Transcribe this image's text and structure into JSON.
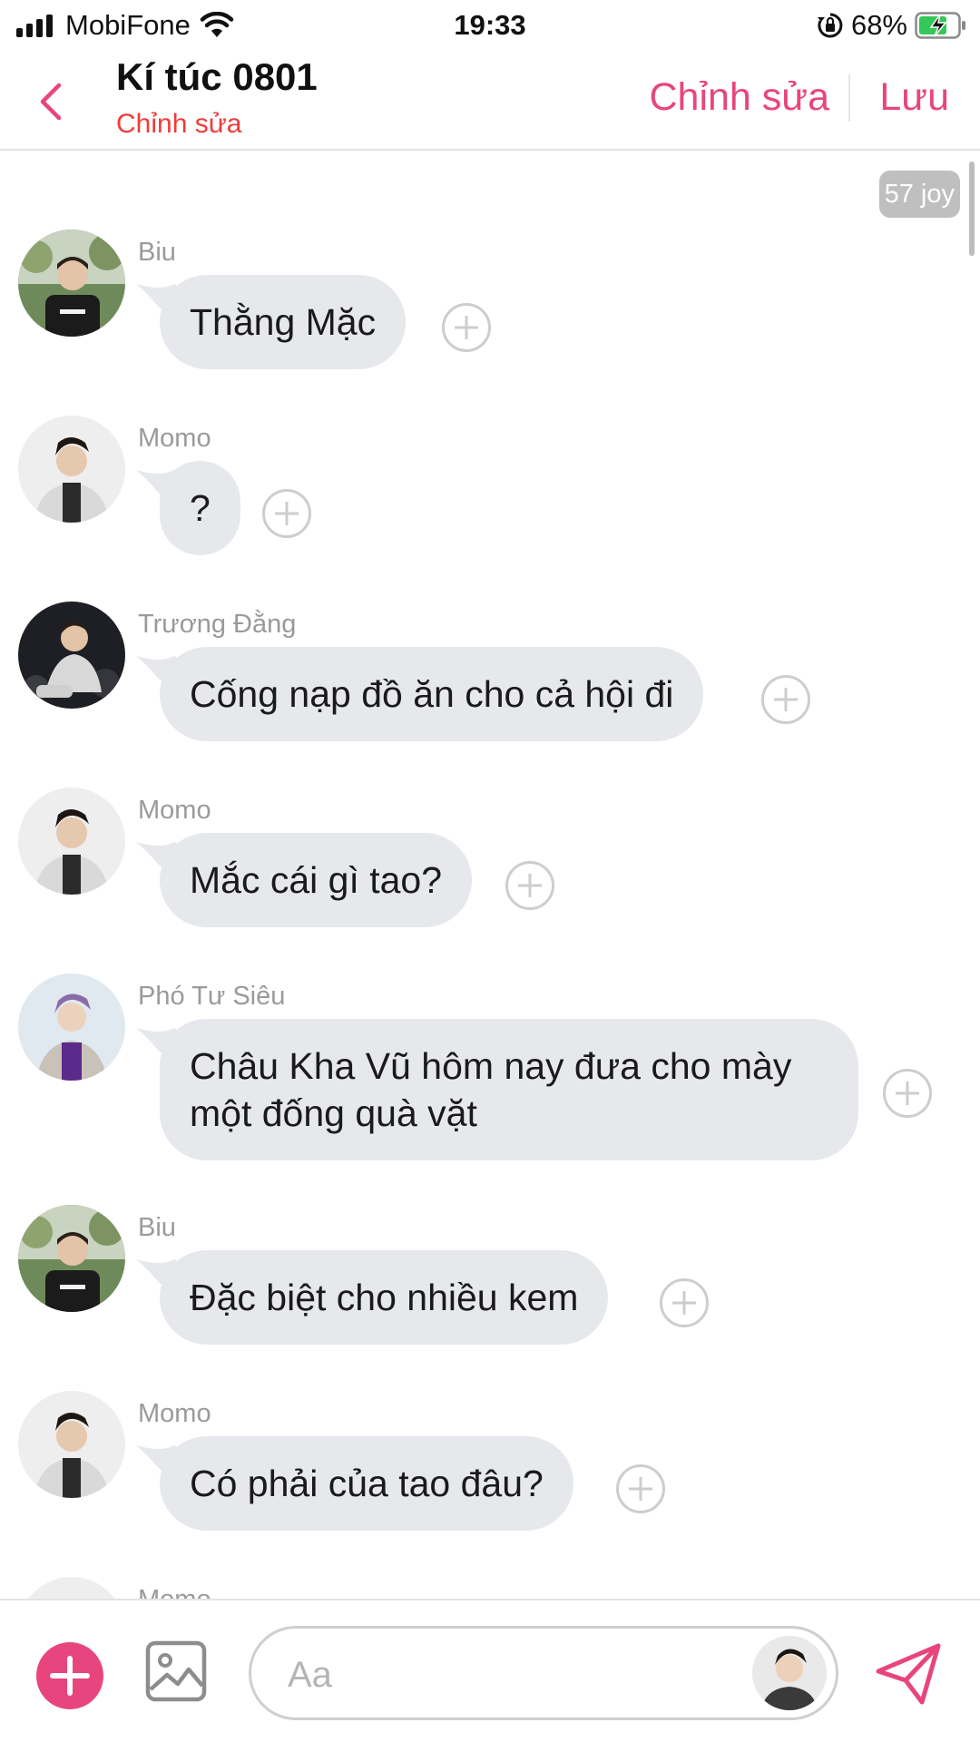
{
  "status_bar": {
    "carrier": "MobiFone",
    "time": "19:33",
    "battery": "68%"
  },
  "header": {
    "title": "Kí túc 0801",
    "subtitle": "Chỉnh sửa",
    "edit_label": "Chỉnh sửa",
    "save_label": "Lưu"
  },
  "chat": {
    "joy_badge": "57 joy",
    "messages": [
      {
        "sender": "Biu",
        "text": "Thằng Mặc"
      },
      {
        "sender": "Momo",
        "text": "?"
      },
      {
        "sender": "Trương Đằng",
        "text": "Cống nạp đồ ăn cho cả hội đi"
      },
      {
        "sender": "Momo",
        "text": "Mắc cái gì tao?"
      },
      {
        "sender": "Phó Tư Siêu",
        "text": "Châu Kha Vũ hôm nay đưa cho mày một đống quà vặt"
      },
      {
        "sender": "Biu",
        "text": "Đặc biệt cho nhiều kem"
      },
      {
        "sender": "Momo",
        "text": "Có phải của tao đâu?"
      },
      {
        "sender": "Momo",
        "text": ""
      }
    ]
  },
  "input": {
    "placeholder": "Aa"
  },
  "colors": {
    "accent": "#e8457e",
    "subtitle_red": "#ef3b3b",
    "bubble": "#e6e8ec",
    "sender_gray": "#9a9a9a"
  },
  "icons": {
    "back": "chevron-left-icon",
    "plus": "plus-circle-icon",
    "add": "add-icon",
    "image": "image-icon",
    "send": "send-icon"
  }
}
